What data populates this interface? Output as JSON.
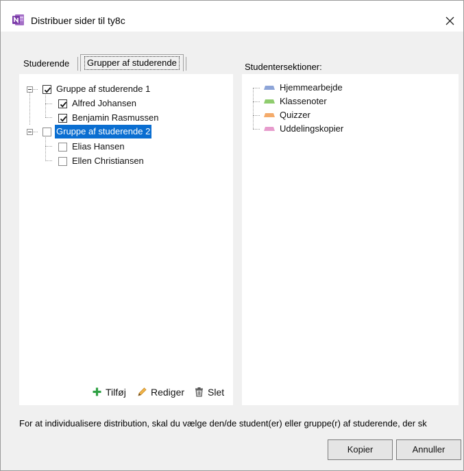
{
  "window": {
    "title": "Distribuer sider til ty8c",
    "app_icon": "onenote-icon",
    "close_icon": "close-icon"
  },
  "tabs": [
    {
      "label": "Studerende",
      "selected": false
    },
    {
      "label": "Grupper af studerende",
      "selected": true
    }
  ],
  "tree": {
    "groups": [
      {
        "label": "Gruppe af studerende 1",
        "checked": true,
        "selected": false,
        "members": [
          {
            "label": "Alfred Johansen",
            "checked": true
          },
          {
            "label": "Benjamin Rasmussen",
            "checked": true
          }
        ]
      },
      {
        "label": "Gruppe af studerende 2",
        "checked": false,
        "selected": true,
        "members": [
          {
            "label": "Elias Hansen",
            "checked": false
          },
          {
            "label": "Ellen Christiansen",
            "checked": false
          }
        ]
      }
    ]
  },
  "actions": {
    "add": {
      "label": "Tilføj",
      "icon": "plus-icon"
    },
    "edit": {
      "label": "Rediger",
      "icon": "pencil-icon"
    },
    "delete": {
      "label": "Slet",
      "icon": "trash-icon"
    }
  },
  "sections": {
    "label": "Studentersektioner:",
    "items": [
      {
        "label": "Hjemmearbejde",
        "color": "#8ea5d8"
      },
      {
        "label": "Klassenoter",
        "color": "#8fcc6e"
      },
      {
        "label": "Quizzer",
        "color": "#f4ab6b"
      },
      {
        "label": "Uddelingskopier",
        "color": "#e79ccd"
      }
    ]
  },
  "hint": "For at individualisere distribution, skal du vælge den/de student(er) eller gruppe(r) af studerende, der sk",
  "buttons": {
    "copy": "Kopier",
    "cancel": "Annuller"
  },
  "colors": {
    "selection": "#0a6ed1",
    "add_icon": "#2ea043",
    "edit_icon": "#e8a33a"
  }
}
